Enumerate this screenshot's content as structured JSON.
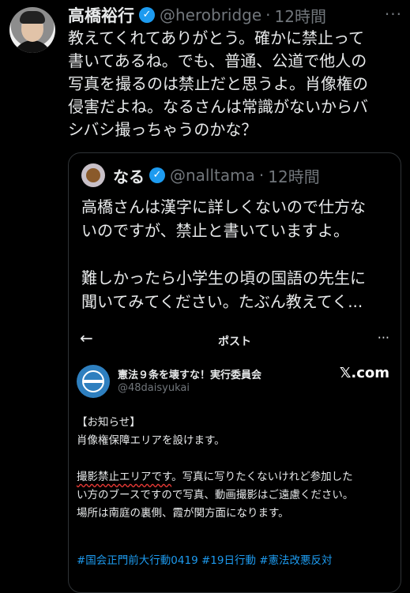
{
  "tweet": {
    "author_name": "高橋裕行",
    "verified_mark": "✓",
    "handle": "@herobridge",
    "separator": "·",
    "time": "12時間",
    "more": "···",
    "text": "教えてくれてありがとう。確かに禁止って\n書いてあるね。でも、普通、公道で他人の\n写真を撮るのは禁止だと思うよ。肖像権の\n侵害だよね。なるさんは常識がないからバ\nシバシ撮っちゃうのかな？"
  },
  "quote": {
    "author_name": "なる",
    "verified_mark": "✓",
    "handle": "@nalltama",
    "separator": "·",
    "time": "12時間",
    "text": "高橋さんは漢字に詳しくないので仕方な\nいのですが、禁止と書いていますよ。\n\n難しかったら小学生の頃の国語の先生に\n聞いてみてください。たぶん教えてく..."
  },
  "embed": {
    "back": "←",
    "title": "ポスト",
    "more": "···",
    "org_name": "憲法９条を壊すな！実行委員会",
    "org_handle": "@48daisyukai",
    "site": "𝕏.com",
    "line1": "【お知らせ】",
    "line2": "肖像権保障エリアを設けます。",
    "underlined": "撮影禁止エリアです",
    "line3_rest": "。写真に写りたくないけれど参加した",
    "line4": "い方のブースですので写真、動画撮影はご遠慮ください。",
    "line5": "場所は南庭の裏側、霞が関方面になります。",
    "hashtags": "#国会正門前大行動0419 #19日行動 #憲法改悪反対"
  }
}
